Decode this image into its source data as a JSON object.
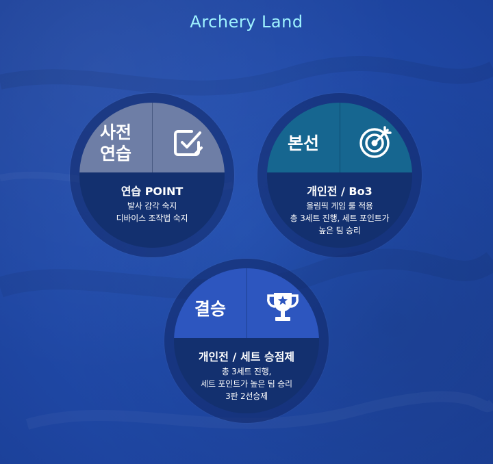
{
  "title": "Archery Land",
  "colors": {
    "background": "#1f47a3",
    "title": "#9ff3ff",
    "practice_top": "#6e7ea6",
    "main_top": "#166690",
    "final_top": "#2d56bf",
    "card_body": "#13306f"
  },
  "cards": [
    {
      "label": "사전\n연습",
      "icon": "checkbox-icon",
      "heading": "연습 POINT",
      "lines": [
        "발사 감각 숙지",
        "디바이스 조작법 숙지"
      ]
    },
    {
      "label": "본선",
      "icon": "target-icon",
      "heading": "개인전 / Bo3",
      "lines": [
        "올림픽 게임 룰 적용",
        "총 3세트 진행, 세트 포인트가",
        "높은 팀 승리"
      ]
    },
    {
      "label": "결승",
      "icon": "trophy-icon",
      "heading": "개인전 / 세트 승점제",
      "lines": [
        "총 3세트 진행,",
        "세트 포인트가 높은 팀 승리",
        "3판 2선승제"
      ]
    }
  ]
}
